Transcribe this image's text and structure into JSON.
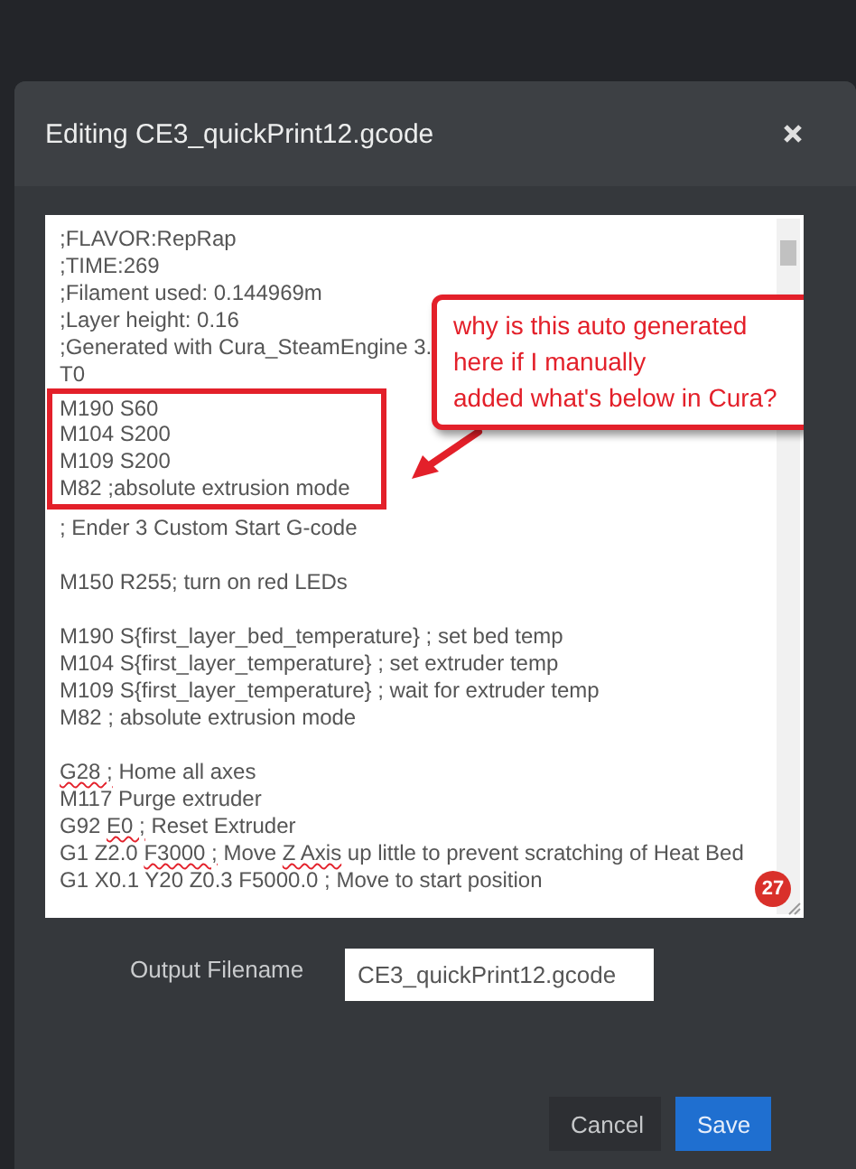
{
  "modal": {
    "title": "Editing CE3_quickPrint12.gcode",
    "editor": {
      "lines": [
        {
          "kind": "code",
          "boxed": false,
          "parts": [
            {
              "text": ";FLAVOR:RepRap",
              "misspelled": false
            }
          ]
        },
        {
          "kind": "code",
          "boxed": false,
          "parts": [
            {
              "text": ";TIME:269",
              "misspelled": false
            }
          ]
        },
        {
          "kind": "code",
          "boxed": false,
          "parts": [
            {
              "text": ";Filament used: 0.144969m",
              "misspelled": false
            }
          ]
        },
        {
          "kind": "code",
          "boxed": false,
          "parts": [
            {
              "text": ";Layer height: 0.16",
              "misspelled": false
            }
          ]
        },
        {
          "kind": "code",
          "boxed": false,
          "parts": [
            {
              "text": ";Generated with Cura_SteamEngine 3.",
              "misspelled": false
            }
          ]
        },
        {
          "kind": "code",
          "boxed": false,
          "parts": [
            {
              "text": "T0",
              "misspelled": false
            }
          ]
        },
        {
          "kind": "code",
          "boxed": true,
          "parts": [
            {
              "text": "M190 S60",
              "misspelled": false
            }
          ]
        },
        {
          "kind": "code",
          "boxed": true,
          "parts": [
            {
              "text": "M104 S200",
              "misspelled": false
            }
          ]
        },
        {
          "kind": "code",
          "boxed": true,
          "parts": [
            {
              "text": "M109 S200",
              "misspelled": false
            }
          ]
        },
        {
          "kind": "code",
          "boxed": true,
          "parts": [
            {
              "text": "M82 ;absolute extrusion mode",
              "misspelled": false
            }
          ]
        },
        {
          "kind": "code",
          "boxed": false,
          "parts": [
            {
              "text": "; Ender 3 Custom Start G-code",
              "misspelled": false
            }
          ]
        },
        {
          "kind": "blank"
        },
        {
          "kind": "code",
          "boxed": false,
          "parts": [
            {
              "text": "M150 R255; turn on red LEDs",
              "misspelled": false
            }
          ]
        },
        {
          "kind": "blank"
        },
        {
          "kind": "code",
          "boxed": false,
          "parts": [
            {
              "text": "M190 S{first_layer_bed_temperature} ; set bed temp",
              "misspelled": false
            }
          ]
        },
        {
          "kind": "code",
          "boxed": false,
          "parts": [
            {
              "text": "M104 S{first_layer_temperature} ; set extruder temp",
              "misspelled": false
            }
          ]
        },
        {
          "kind": "code",
          "boxed": false,
          "parts": [
            {
              "text": "M109 S{first_layer_temperature} ; wait for extruder temp",
              "misspelled": false
            }
          ]
        },
        {
          "kind": "code",
          "boxed": false,
          "parts": [
            {
              "text": "M82 ; absolute extrusion mode",
              "misspelled": false
            }
          ]
        },
        {
          "kind": "blank"
        },
        {
          "kind": "code",
          "boxed": false,
          "parts": [
            {
              "text": "G28 ;",
              "misspelled": true
            },
            {
              "text": " Home all axes",
              "misspelled": false
            }
          ]
        },
        {
          "kind": "code",
          "boxed": false,
          "parts": [
            {
              "text": "M117 Purge extruder",
              "misspelled": false
            }
          ]
        },
        {
          "kind": "code",
          "boxed": false,
          "parts": [
            {
              "text": "G92 ",
              "misspelled": false
            },
            {
              "text": "E0 ;",
              "misspelled": true
            },
            {
              "text": " Reset Extruder",
              "misspelled": false
            }
          ]
        },
        {
          "kind": "code",
          "boxed": false,
          "parts": [
            {
              "text": "G1 Z2.0 ",
              "misspelled": false
            },
            {
              "text": "F3000 ;",
              "misspelled": true
            },
            {
              "text": " Move ",
              "misspelled": false
            },
            {
              "text": "Z Axis",
              "misspelled": true
            },
            {
              "text": " up little to prevent scratching of Heat Bed",
              "misspelled": false
            }
          ]
        },
        {
          "kind": "code",
          "boxed": false,
          "parts": [
            {
              "text": "G1 X0.1 Y20 Z0.3 F5000.0 ; Move to start position",
              "misspelled": false
            }
          ]
        }
      ]
    },
    "output_filename": {
      "label": "Output Filename",
      "value": "CE3_quickPrint12.gcode"
    },
    "buttons": [
      {
        "label": "Cancel",
        "kind": "secondary"
      },
      {
        "label": "Save",
        "kind": "primary"
      }
    ]
  },
  "annotation": {
    "callout_lines": [
      "why is this auto generated",
      "here if I manually",
      "added what's below in Cura?"
    ],
    "badge": "27"
  }
}
